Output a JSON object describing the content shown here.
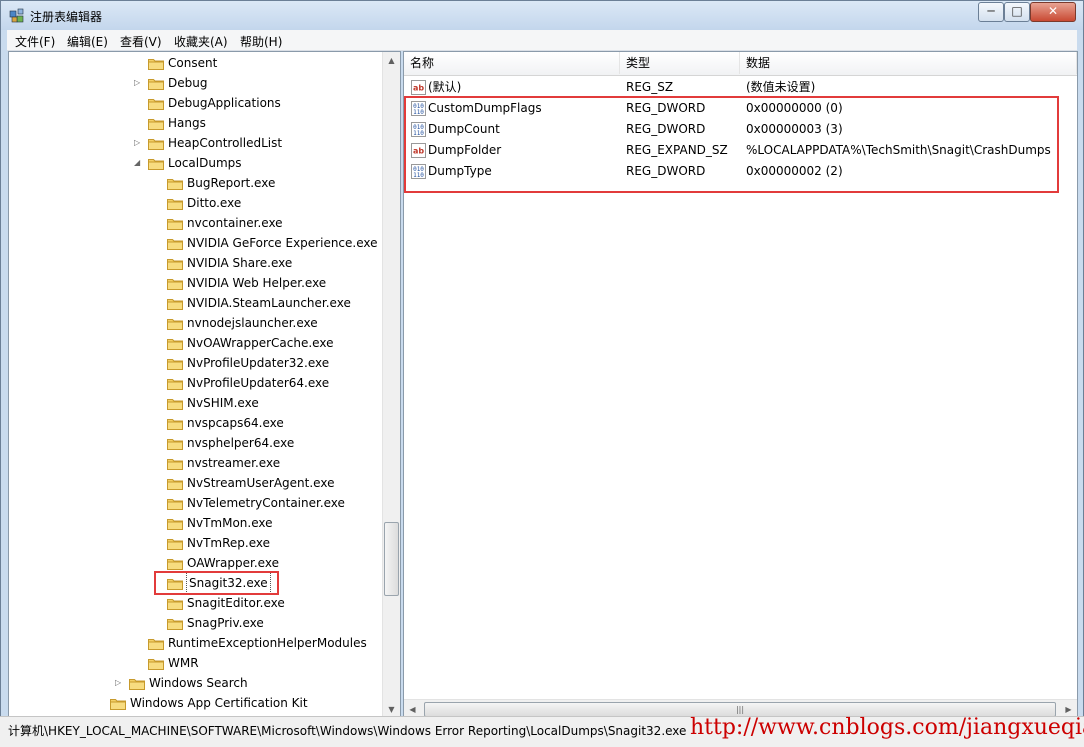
{
  "window": {
    "title": "注册表编辑器",
    "controls": {
      "min": "─",
      "max": "□",
      "close": "✕"
    }
  },
  "menu": [
    "文件(F)",
    "编辑(E)",
    "查看(V)",
    "收藏夹(A)",
    "帮助(H)"
  ],
  "tree": [
    {
      "label": "Consent",
      "depth": 2,
      "expander": ""
    },
    {
      "label": "Debug",
      "depth": 2,
      "expander": "▷"
    },
    {
      "label": "DebugApplications",
      "depth": 2,
      "expander": ""
    },
    {
      "label": "Hangs",
      "depth": 2,
      "expander": ""
    },
    {
      "label": "HeapControlledList",
      "depth": 2,
      "expander": "▷"
    },
    {
      "label": "LocalDumps",
      "depth": 2,
      "expander": "◢"
    },
    {
      "label": "BugReport.exe",
      "depth": 3,
      "expander": ""
    },
    {
      "label": "Ditto.exe",
      "depth": 3,
      "expander": ""
    },
    {
      "label": "nvcontainer.exe",
      "depth": 3,
      "expander": ""
    },
    {
      "label": "NVIDIA GeForce Experience.exe",
      "depth": 3,
      "expander": ""
    },
    {
      "label": "NVIDIA Share.exe",
      "depth": 3,
      "expander": ""
    },
    {
      "label": "NVIDIA Web Helper.exe",
      "depth": 3,
      "expander": ""
    },
    {
      "label": "NVIDIA.SteamLauncher.exe",
      "depth": 3,
      "expander": ""
    },
    {
      "label": "nvnodejslauncher.exe",
      "depth": 3,
      "expander": ""
    },
    {
      "label": "NvOAWrapperCache.exe",
      "depth": 3,
      "expander": ""
    },
    {
      "label": "NvProfileUpdater32.exe",
      "depth": 3,
      "expander": ""
    },
    {
      "label": "NvProfileUpdater64.exe",
      "depth": 3,
      "expander": ""
    },
    {
      "label": "NvSHIM.exe",
      "depth": 3,
      "expander": ""
    },
    {
      "label": "nvspcaps64.exe",
      "depth": 3,
      "expander": ""
    },
    {
      "label": "nvsphelper64.exe",
      "depth": 3,
      "expander": ""
    },
    {
      "label": "nvstreamer.exe",
      "depth": 3,
      "expander": ""
    },
    {
      "label": "NvStreamUserAgent.exe",
      "depth": 3,
      "expander": ""
    },
    {
      "label": "NvTelemetryContainer.exe",
      "depth": 3,
      "expander": ""
    },
    {
      "label": "NvTmMon.exe",
      "depth": 3,
      "expander": ""
    },
    {
      "label": "NvTmRep.exe",
      "depth": 3,
      "expander": ""
    },
    {
      "label": "OAWrapper.exe",
      "depth": 3,
      "expander": ""
    },
    {
      "label": "Snagit32.exe",
      "depth": 3,
      "expander": "",
      "selected": true
    },
    {
      "label": "SnagitEditor.exe",
      "depth": 3,
      "expander": ""
    },
    {
      "label": "SnagPriv.exe",
      "depth": 3,
      "expander": ""
    },
    {
      "label": "RuntimeExceptionHelperModules",
      "depth": 2,
      "expander": ""
    },
    {
      "label": "WMR",
      "depth": 2,
      "expander": ""
    },
    {
      "label": "Windows Search",
      "depth": 1,
      "expander": "▷"
    },
    {
      "label": "Windows App Certification Kit",
      "depth": 0,
      "expander": ""
    }
  ],
  "list": {
    "columns": [
      "名称",
      "类型",
      "数据"
    ],
    "rows": [
      {
        "icon": "string-value-icon",
        "name": "(默认)",
        "type": "REG_SZ",
        "data": "(数值未设置)"
      },
      {
        "icon": "binary-value-icon",
        "name": "CustomDumpFlags",
        "type": "REG_DWORD",
        "data": "0x00000000 (0)"
      },
      {
        "icon": "binary-value-icon",
        "name": "DumpCount",
        "type": "REG_DWORD",
        "data": "0x00000003 (3)"
      },
      {
        "icon": "string-value-icon",
        "name": "DumpFolder",
        "type": "REG_EXPAND_SZ",
        "data": "%LOCALAPPDATA%\\TechSmith\\Snagit\\CrashDumps"
      },
      {
        "icon": "binary-value-icon",
        "name": "DumpType",
        "type": "REG_DWORD",
        "data": "0x00000002 (2)"
      }
    ]
  },
  "status": {
    "path": "计算机\\HKEY_LOCAL_MACHINE\\SOFTWARE\\Microsoft\\Windows\\Windows Error Reporting\\LocalDumps\\Snagit32.exe",
    "watermark": "http://www.cnblogs.com/jiangxueqiao/"
  },
  "colors": {
    "highlight": "#e23b3b",
    "folder": "#f1c84a",
    "watermark": "#cc0000"
  }
}
